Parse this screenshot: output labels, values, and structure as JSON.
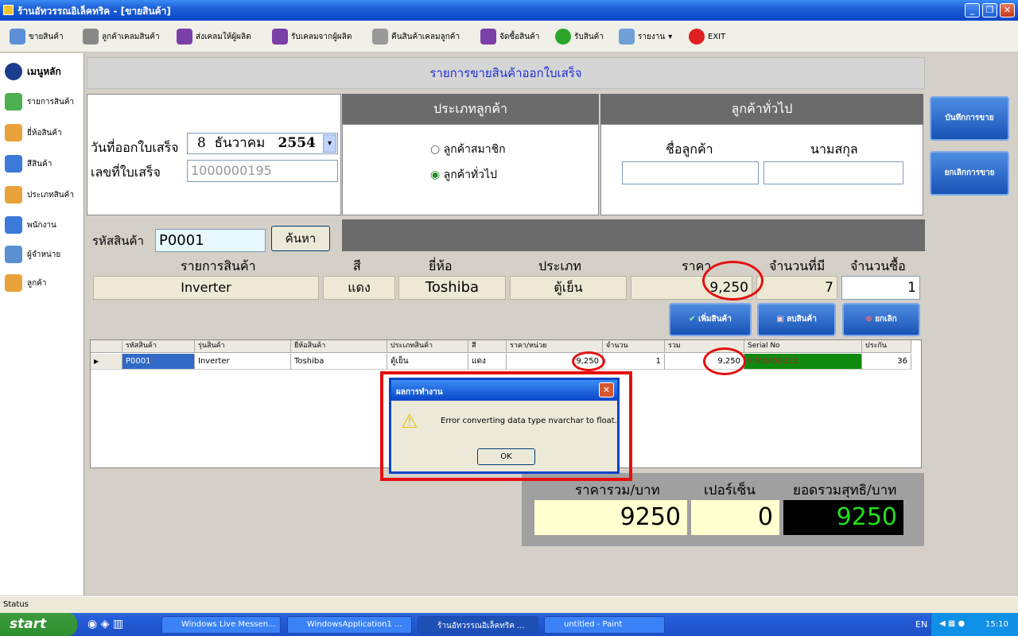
{
  "window": {
    "title": "ร้านอัทวรรณอิเล็คทริค - [ขายสินค้า]"
  },
  "toolbar": [
    "ขายสินค้า",
    "ลูกค้าเคลมสินค้า",
    "ส่งเคลมให้ผู้ผลิต",
    "รับเคลมจากผู้ผลิต",
    "คืนสินค้าเคลมลูกค้า",
    "จัดซื้อสินค้า",
    "รับสินค้า",
    "รายงาน",
    "EXIT"
  ],
  "sidebar": {
    "home": "เมนูหลัก",
    "items": [
      "รายการสินค้า",
      "ยี่ห้อสินค้า",
      "สีสินค้า",
      "ประเภทสินค้า",
      "พนักงาน",
      "ผู้จำหน่าย",
      "ลูกค้า"
    ]
  },
  "header": "รายการขายสินค้าออกใบเสร็จ",
  "invoice": {
    "date_label": "วันที่ออกใบเสร็จ",
    "date_day": "8",
    "date_month": "ธันวาคม",
    "date_year": "2554",
    "no_label": "เลขที่ใบเสร็จ",
    "no_value": "1000000195"
  },
  "customer_type": {
    "title": "ประเภทลูกค้า",
    "options": [
      "ลูกค้าสมาชิก",
      "ลูกค้าทั่วไป"
    ],
    "selected": "ลูกค้าทั่วไป"
  },
  "general": {
    "title": "ลูกค้าทั่วไป",
    "name_label": "ชื่อลูกค้า",
    "surname_label": "นามสกุล",
    "name": "",
    "surname": ""
  },
  "actions": {
    "save": "บันทึกการขาย",
    "cancel": "ยกเลิกการขาย"
  },
  "product": {
    "code_label": "รหัสสินค้า",
    "code": "P0001",
    "search": "ค้นหา",
    "headers": [
      "รายการสินค้า",
      "สี",
      "ยี่ห้อ",
      "ประเภท",
      "ราคา",
      "จำนวนที่มี",
      "จำนวนซื้อ"
    ],
    "name": "Inverter",
    "color": "แดง",
    "brand": "Toshiba",
    "type": "ตู้เย็น",
    "price": "9,250",
    "stock": "7",
    "qty": "1"
  },
  "buttons": {
    "add": "เพิ่มสินค้า",
    "remove": "ลบสินค้า",
    "cancel": "ยกเลิก"
  },
  "grid": {
    "columns": [
      "รหัสสินค้า",
      "รุ่นสินค้า",
      "ยี่ห้อสินค้า",
      "ประเภทสินค้า",
      "สี",
      "ราคา/หน่วย",
      "จำนวน",
      "รวม",
      "Serial No",
      "ประกัน"
    ],
    "row": [
      "P0001",
      "Inverter",
      "Toshiba",
      "ตู้เย็น",
      "แดง",
      "9,250",
      "1",
      "9,250",
      "9765456322",
      "36"
    ]
  },
  "dialog": {
    "title": "ผลการทำงาน",
    "message": "Error converting data type nvarchar to float.",
    "ok": "OK"
  },
  "totals": {
    "sum_label": "ราคารวม/บาท",
    "pct_label": "เปอร์เซ็น",
    "net_label": "ยอดรวมสุทธิ/บาท",
    "sum": "9250",
    "pct": "0",
    "net": "9250"
  },
  "status": "Status",
  "taskbar": {
    "start": "start",
    "tasks": [
      "Windows Live Messen...",
      "WindowsApplication1 ...",
      "ร้านอัทวรรณอิเล็คทริค ...",
      "untitled - Paint"
    ],
    "lang": "EN",
    "time": "15:10"
  }
}
